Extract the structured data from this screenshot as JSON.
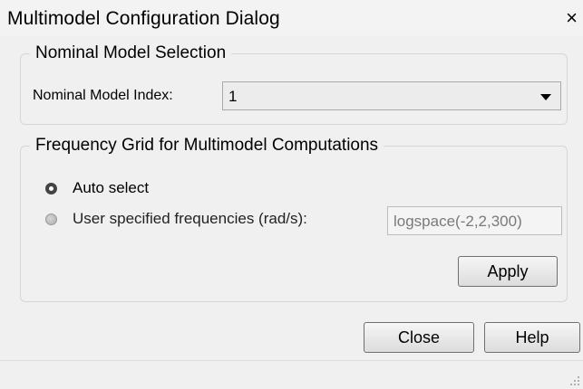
{
  "window": {
    "title": "Multimodel Configuration Dialog",
    "close_glyph": "×"
  },
  "nominal": {
    "group_label": "Nominal Model Selection",
    "index_label": "Nominal Model Index:",
    "index_value": "1"
  },
  "frequency": {
    "group_label": "Frequency Grid for Multimodel Computations",
    "options": [
      {
        "label": "Auto select",
        "selected": true
      },
      {
        "label": "User specified frequencies (rad/s):",
        "selected": false
      }
    ],
    "input_value": "logspace(-2,2,300)",
    "apply_label": "Apply"
  },
  "footer": {
    "close_label": "Close",
    "help_label": "Help"
  },
  "icons": {
    "close": "close-icon",
    "dropdown": "chevron-down-icon",
    "resize": "resize-grip-icon"
  }
}
